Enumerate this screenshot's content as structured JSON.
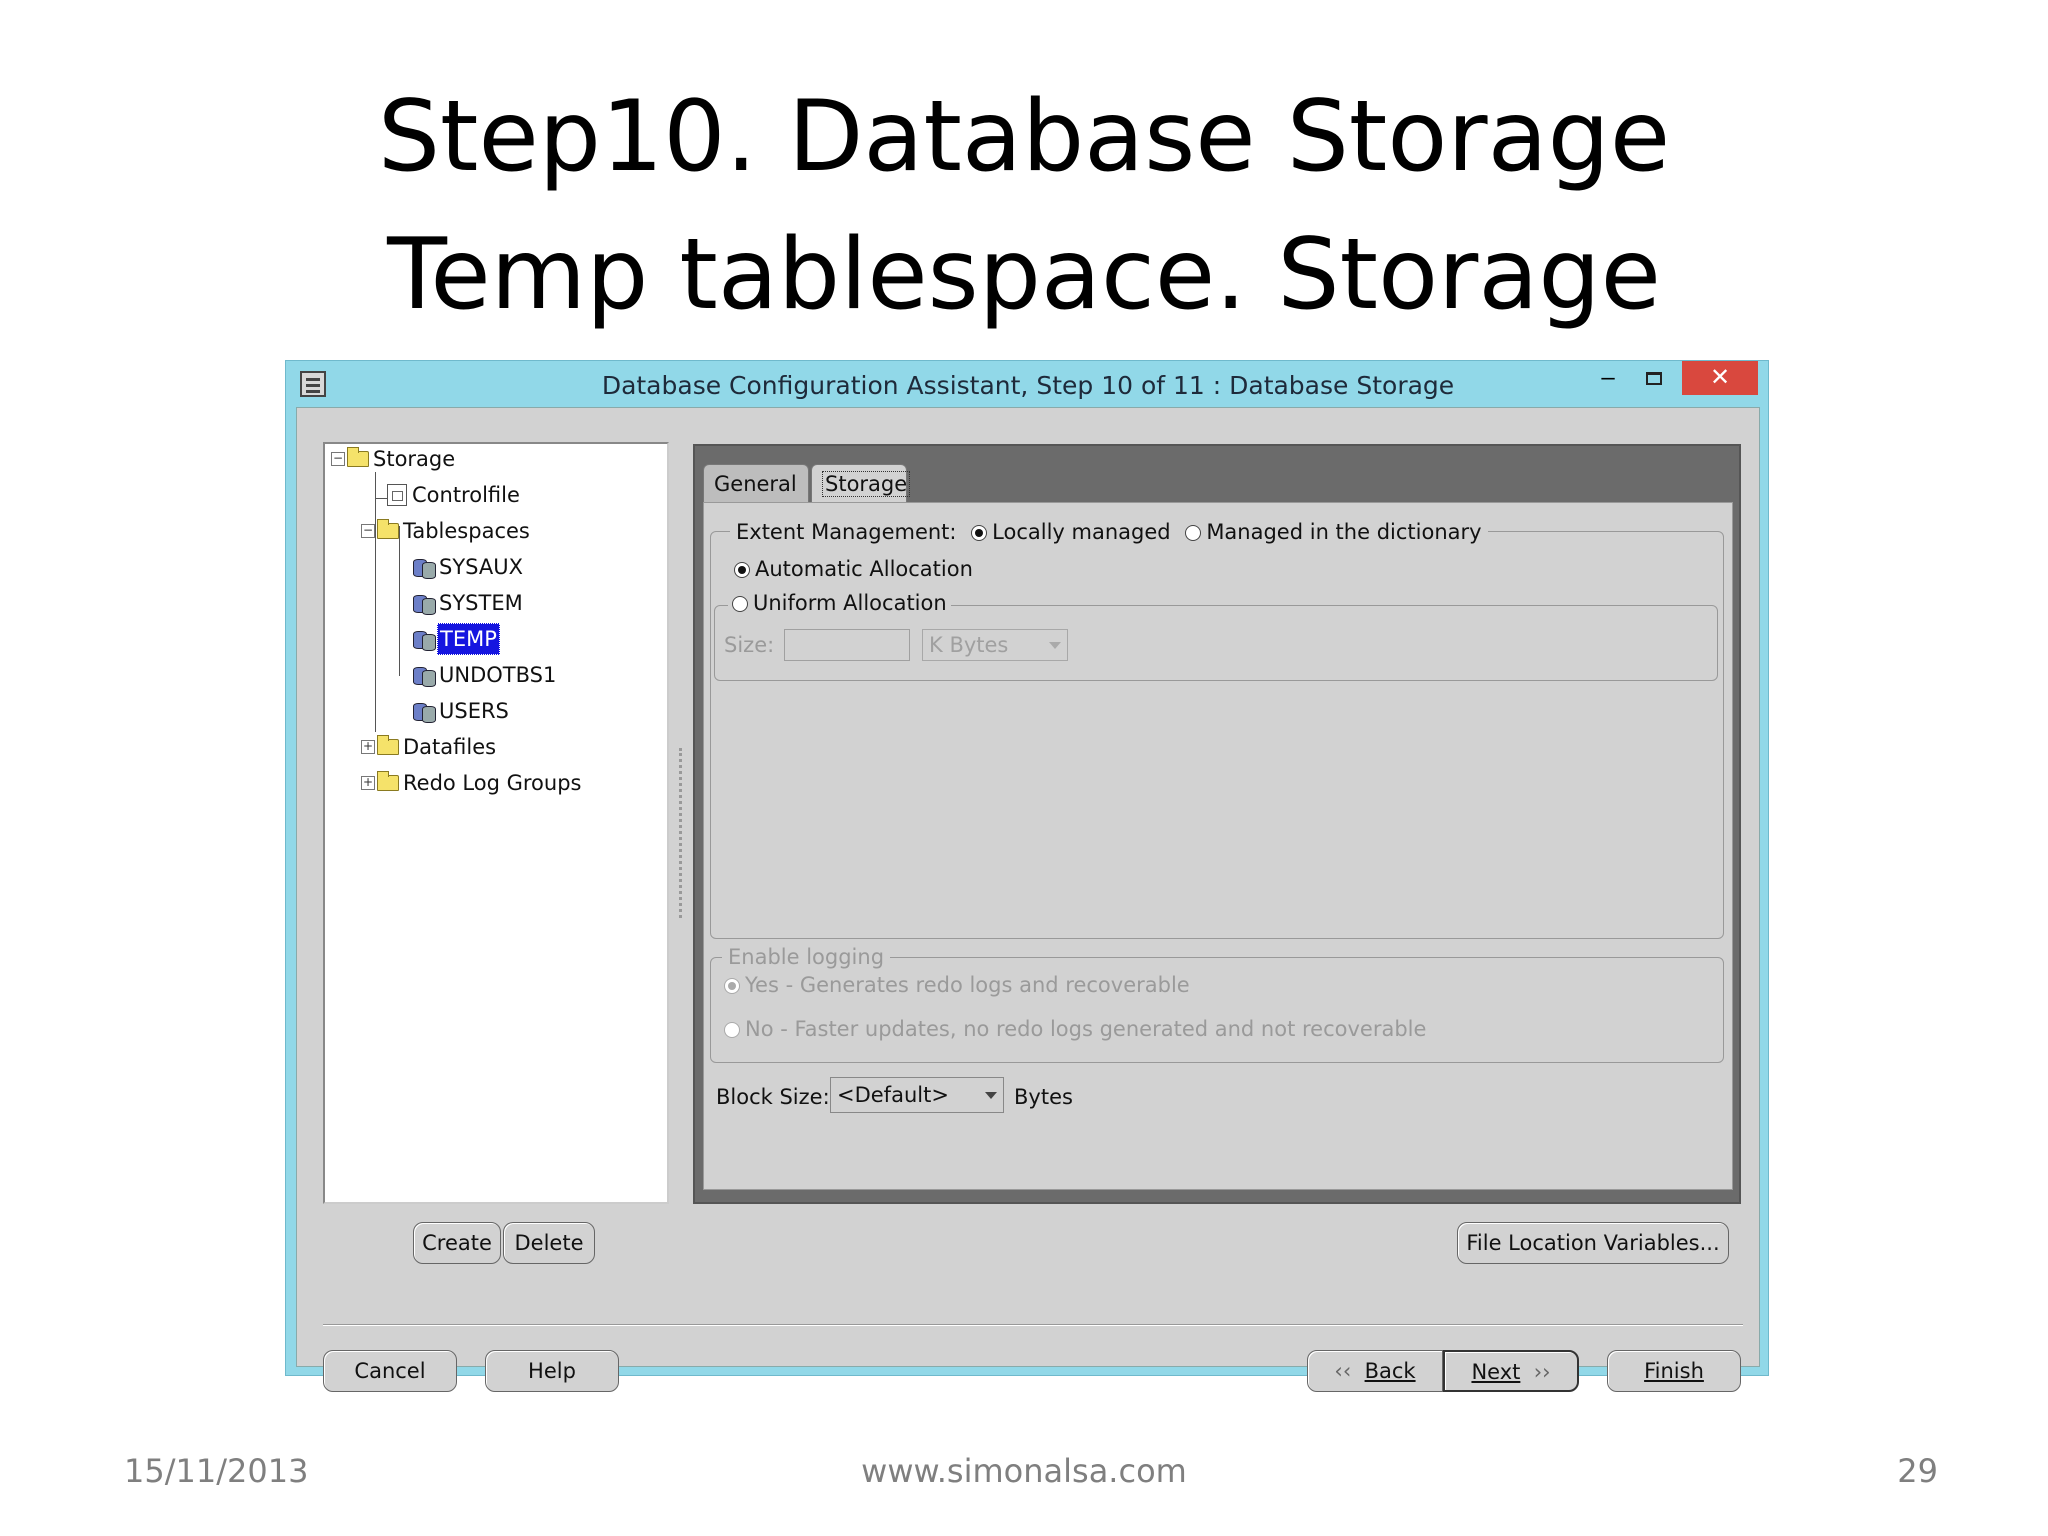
{
  "slide": {
    "title_line1": "Step10. Database Storage",
    "title_line2": "Temp tablespace. Storage",
    "footer_date": "15/11/2013",
    "footer_url": "www.simonalsa.com",
    "footer_page": "29"
  },
  "window": {
    "title": "Database Configuration Assistant, Step 10 of 11 : Database Storage",
    "controls": {
      "minimize": "–",
      "close": "✕"
    }
  },
  "tree": {
    "root": "Storage",
    "controlfile": "Controlfile",
    "tablespaces": "Tablespaces",
    "tablespace_items": [
      "SYSAUX",
      "SYSTEM",
      "TEMP",
      "UNDOTBS1",
      "USERS"
    ],
    "selected": "TEMP",
    "datafiles": "Datafiles",
    "redo_log_groups": "Redo Log Groups"
  },
  "tree_buttons": {
    "create": "Create",
    "delete": "Delete"
  },
  "tabs": {
    "general": "General",
    "storage": "Storage",
    "active": "Storage"
  },
  "storage": {
    "extent_management_label": "Extent Management:",
    "locally_managed": "Locally managed",
    "managed_in_dictionary": "Managed in the dictionary",
    "extent_selected": "Locally managed",
    "automatic_allocation": "Automatic Allocation",
    "uniform_allocation": "Uniform Allocation",
    "allocation_selected": "Automatic Allocation",
    "size_label": "Size:",
    "size_value": "",
    "size_unit": "K Bytes",
    "enable_logging_label": "Enable logging",
    "logging_yes": "Yes - Generates redo logs and recoverable",
    "logging_no": "No - Faster updates, no redo logs generated and not recoverable",
    "logging_selected": "Yes",
    "block_size_label": "Block Size:",
    "block_size_value": "<Default>",
    "block_size_unit": "Bytes"
  },
  "buttons": {
    "file_location_variables": "File Location Variables...",
    "cancel": "Cancel",
    "help": "Help",
    "back": "Back",
    "next": "Next",
    "finish": "Finish"
  },
  "colors": {
    "titlebar": "#91d8e8",
    "close_button": "#d9483e",
    "selection": "#1515e0",
    "dialog_bg": "#d2d2d2"
  }
}
